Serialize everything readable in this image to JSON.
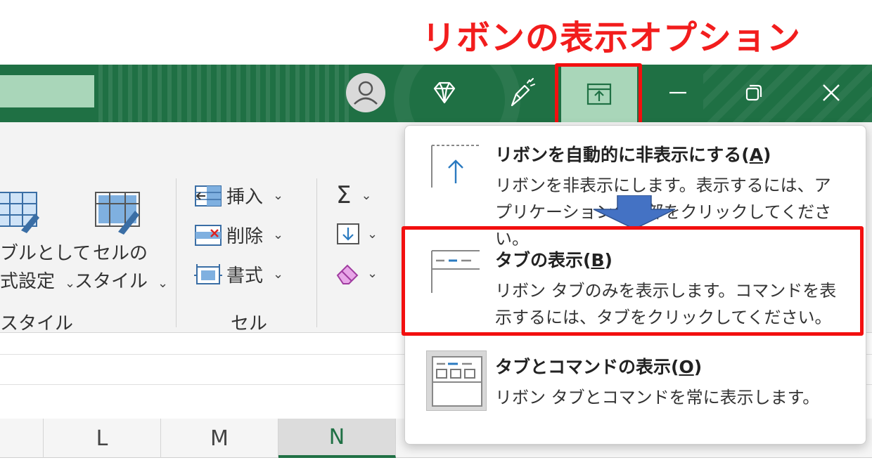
{
  "annotation": {
    "title": "リボンの表示オプション",
    "color": "#f21d1d"
  },
  "titlebar": {
    "bg_color": "#1f7044",
    "icons": [
      "account-icon",
      "diamond-icon",
      "pen-icon",
      "ribbon-display-options-icon",
      "minimize-icon",
      "restore-icon",
      "close-icon"
    ]
  },
  "ribbon": {
    "group_styles": {
      "format_as_table": [
        "ブルとして",
        "式設定"
      ],
      "cell_styles": [
        "セルの",
        "スタイル"
      ],
      "label": "スタイル"
    },
    "group_cells": {
      "insert": "挿入",
      "delete": "削除",
      "format": "書式",
      "label": "セル"
    },
    "group_edit": {
      "sum_icon": "Σ"
    }
  },
  "columns": [
    "L",
    "M",
    "N"
  ],
  "selected_column": "N",
  "menu": {
    "items": [
      {
        "title_prefix": "リボンを自動的に非表示にする(",
        "key": "A",
        "title_suffix": ")",
        "desc": "リボンを非表示にします。表示するには、アプリケーションの上部をクリックしてください。"
      },
      {
        "title_prefix": "タブの表示(",
        "key": "B",
        "title_suffix": ")",
        "desc": "リボン タブのみを表示します。コマンドを表示するには、タブをクリックしてください。"
      },
      {
        "title_prefix": "タブとコマンドの表示(",
        "key": "O",
        "title_suffix": ")",
        "desc": "リボン タブとコマンドを常に表示します。"
      }
    ]
  },
  "highlight_color": "#f20f0f"
}
